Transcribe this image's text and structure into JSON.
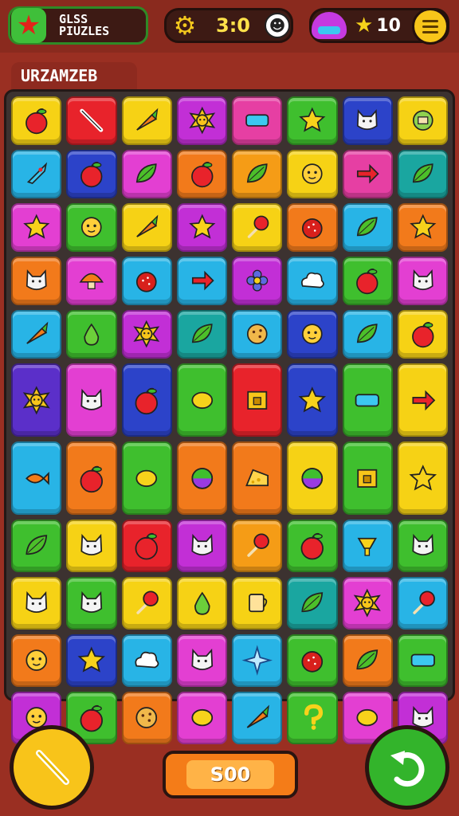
{
  "header": {
    "logo_line1": "GLSS",
    "logo_line2": "PIUZLES",
    "timer": "3:0",
    "stars": "10"
  },
  "level_title": "URZAMZEB",
  "footer": {
    "score_label": "S00"
  },
  "icons": {
    "logo": "star-icon",
    "timer": "gear-icon",
    "opponent": "face-icon",
    "powerup": "mushroom-icon",
    "stars": "star-icon",
    "menu": "menu-icon",
    "left_action": "hammer-icon",
    "right_action": "undo-icon"
  },
  "board": {
    "columns": 8,
    "rows": [
      [
        {
          "color": "#f6d215",
          "icon": "apple"
        },
        {
          "color": "#e8232b",
          "icon": "knife"
        },
        {
          "color": "#f6d215",
          "icon": "carrot"
        },
        {
          "color": "#c22fd6",
          "icon": "sun"
        },
        {
          "color": "#e63fa3",
          "icon": "bar"
        },
        {
          "color": "#3fbf2e",
          "icon": "star"
        },
        {
          "color": "#2c43c9",
          "icon": "cat"
        },
        {
          "color": "#f6d215",
          "icon": "shell"
        }
      ],
      [
        {
          "color": "#28b4e6",
          "icon": "rocket"
        },
        {
          "color": "#2c43c9",
          "icon": "apple"
        },
        {
          "color": "#e33fd2",
          "icon": "leaf"
        },
        {
          "color": "#f27a1b",
          "icon": "apple"
        },
        {
          "color": "#f59c16",
          "icon": "leaf"
        },
        {
          "color": "#f6d215",
          "icon": "face"
        },
        {
          "color": "#e63fa3",
          "icon": "arrow"
        },
        {
          "color": "#1aa6a0",
          "icon": "leaf"
        }
      ],
      [
        {
          "color": "#e33fd2",
          "icon": "star"
        },
        {
          "color": "#3fbf2e",
          "icon": "face"
        },
        {
          "color": "#f6d215",
          "icon": "carrot"
        },
        {
          "color": "#c22fd6",
          "icon": "star"
        },
        {
          "color": "#f6d215",
          "icon": "lolly"
        },
        {
          "color": "#f27a1b",
          "icon": "berry"
        },
        {
          "color": "#28b4e6",
          "icon": "leaf"
        },
        {
          "color": "#f27a1b",
          "icon": "star"
        }
      ],
      [
        {
          "color": "#f27a1b",
          "icon": "cat"
        },
        {
          "color": "#e33fd2",
          "icon": "mushroom"
        },
        {
          "color": "#28b4e6",
          "icon": "berry"
        },
        {
          "color": "#28b4e6",
          "icon": "arrow"
        },
        {
          "color": "#c22fd6",
          "icon": "flower"
        },
        {
          "color": "#28b4e6",
          "icon": "cloud"
        },
        {
          "color": "#3fbf2e",
          "icon": "apple"
        },
        {
          "color": "#e33fd2",
          "icon": "cat"
        }
      ],
      [
        {
          "color": "#28b4e6",
          "icon": "carrot"
        },
        {
          "color": "#3fbf2e",
          "icon": "pear"
        },
        {
          "color": "#c22fd6",
          "icon": "sun"
        },
        {
          "color": "#1aa6a0",
          "icon": "leaf"
        },
        {
          "color": "#28b4e6",
          "icon": "cookie"
        },
        {
          "color": "#2c43c9",
          "icon": "face"
        },
        {
          "color": "#28b4e6",
          "icon": "leaf"
        },
        {
          "color": "#f6d215",
          "icon": "apple"
        }
      ],
      [
        {
          "color": "#5b2fc9",
          "icon": "sun"
        },
        {
          "color": "#e33fd2",
          "icon": "cat"
        },
        {
          "color": "#2c43c9",
          "icon": "apple"
        },
        {
          "color": "#3fbf2e",
          "icon": "lemon"
        },
        {
          "color": "#e8232b",
          "icon": "box"
        },
        {
          "color": "#2c43c9",
          "icon": "star"
        },
        {
          "color": "#3fbf2e",
          "icon": "bar"
        },
        {
          "color": "#f6d215",
          "icon": "arrow"
        }
      ],
      [
        {
          "color": "#28b4e6",
          "icon": "fish"
        },
        {
          "color": "#f27a1b",
          "icon": "apple"
        },
        {
          "color": "#3fbf2e",
          "icon": "lemon"
        },
        {
          "color": "#f27a1b",
          "icon": "ball"
        },
        {
          "color": "#f27a1b",
          "icon": "cheese"
        },
        {
          "color": "#f6d215",
          "icon": "ball"
        },
        {
          "color": "#3fbf2e",
          "icon": "box"
        },
        {
          "color": "#f6d215",
          "icon": "star"
        }
      ],
      [
        {
          "color": "#3fbf2e",
          "icon": "leaf"
        },
        {
          "color": "#f6d215",
          "icon": "cat"
        },
        {
          "color": "#e8232b",
          "icon": "apple"
        },
        {
          "color": "#c22fd6",
          "icon": "cat"
        },
        {
          "color": "#f59c16",
          "icon": "lolly"
        },
        {
          "color": "#3fbf2e",
          "icon": "apple"
        },
        {
          "color": "#28b4e6",
          "icon": "lamp"
        },
        {
          "color": "#3fbf2e",
          "icon": "cat"
        }
      ],
      [
        {
          "color": "#f6d215",
          "icon": "cat"
        },
        {
          "color": "#3fbf2e",
          "icon": "cat"
        },
        {
          "color": "#f6d215",
          "icon": "lolly"
        },
        {
          "color": "#f6d215",
          "icon": "pear"
        },
        {
          "color": "#f6d215",
          "icon": "cup"
        },
        {
          "color": "#1aa6a0",
          "icon": "leaf"
        },
        {
          "color": "#e33fd2",
          "icon": "sun"
        },
        {
          "color": "#28b4e6",
          "icon": "lolly"
        }
      ],
      [
        {
          "color": "#f27a1b",
          "icon": "face"
        },
        {
          "color": "#2c43c9",
          "icon": "star"
        },
        {
          "color": "#28b4e6",
          "icon": "cloud"
        },
        {
          "color": "#e33fd2",
          "icon": "cat"
        },
        {
          "color": "#28b4e6",
          "icon": "sparkle"
        },
        {
          "color": "#3fbf2e",
          "icon": "berry"
        },
        {
          "color": "#f27a1b",
          "icon": "leaf"
        },
        {
          "color": "#3fbf2e",
          "icon": "bar"
        }
      ],
      [
        {
          "color": "#c22fd6",
          "icon": "face"
        },
        {
          "color": "#3fbf2e",
          "icon": "apple"
        },
        {
          "color": "#f27a1b",
          "icon": "cookie"
        },
        {
          "color": "#e33fd2",
          "icon": "lemon"
        },
        {
          "color": "#28b4e6",
          "icon": "carrot"
        },
        {
          "color": "#3fbf2e",
          "icon": "question"
        },
        {
          "color": "#e33fd2",
          "icon": "lemon"
        },
        {
          "color": "#c22fd6",
          "icon": "cat"
        }
      ]
    ]
  }
}
